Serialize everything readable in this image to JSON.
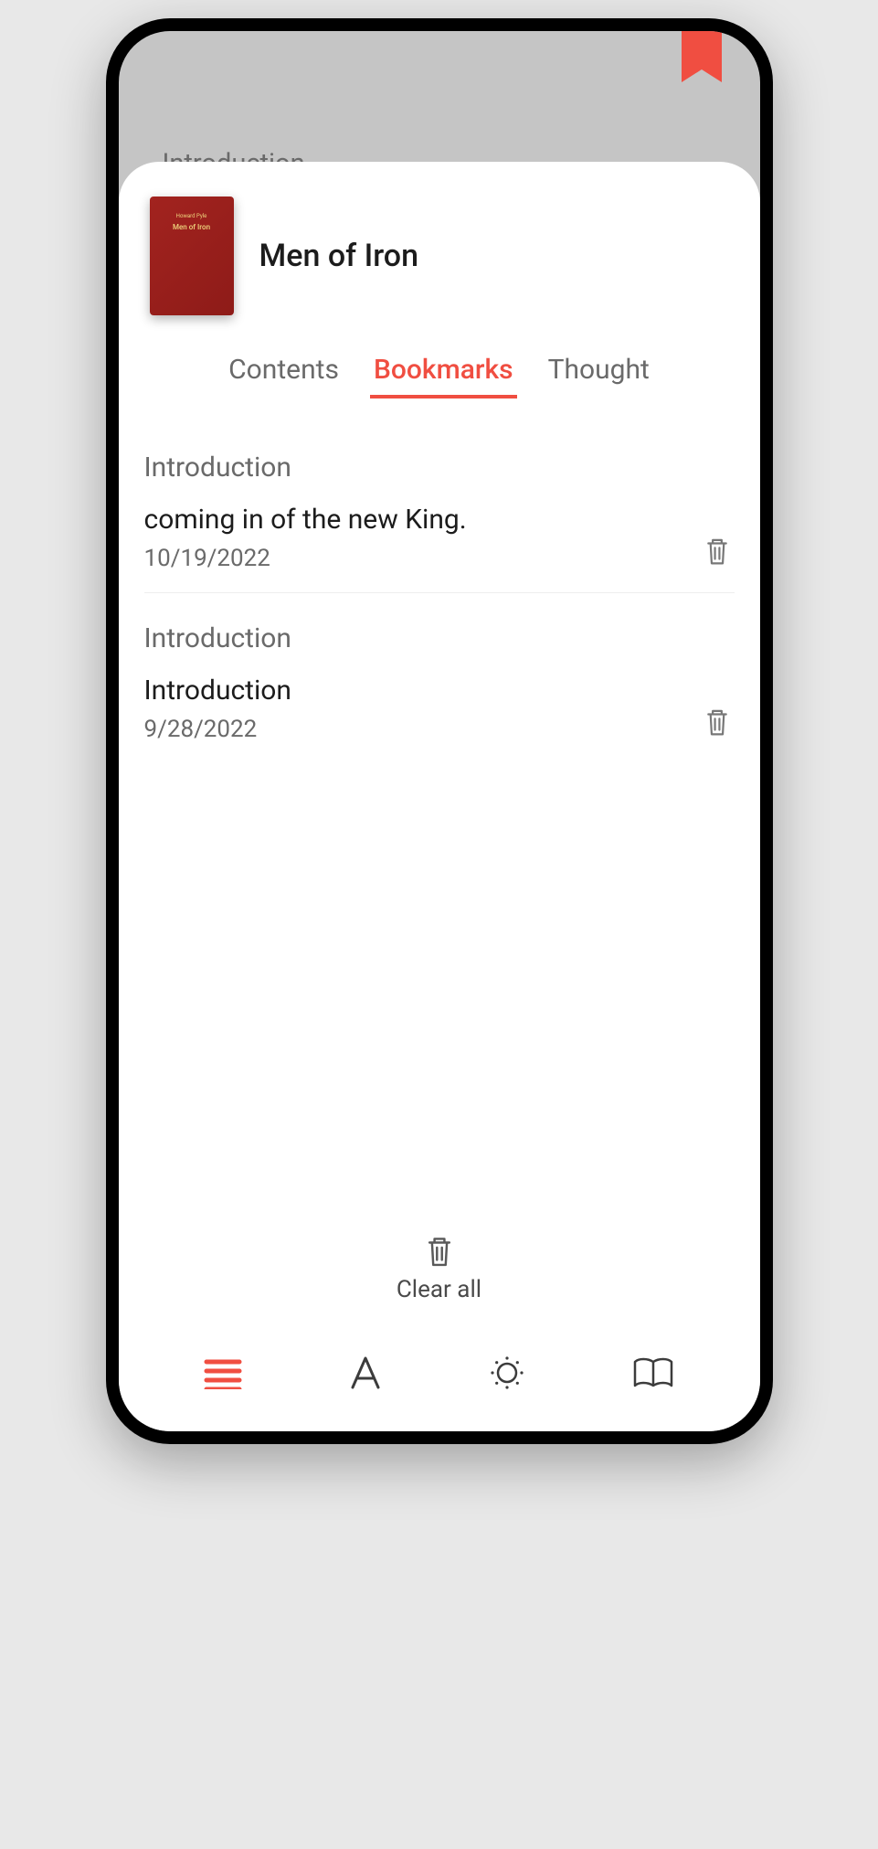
{
  "underlay": {
    "chapter": "Introduction"
  },
  "book": {
    "cover_author": "Howard Pyle",
    "cover_title": "Men of Iron",
    "title": "Men of Iron"
  },
  "tabs": {
    "contents": "Contents",
    "bookmarks": "Bookmarks",
    "thought": "Thought"
  },
  "bookmarks": [
    {
      "chapter": "Introduction",
      "excerpt": "coming in of the new King.",
      "date": "10/19/2022"
    },
    {
      "chapter": "Introduction",
      "excerpt": "Introduction",
      "date": "9/28/2022"
    }
  ],
  "clear_all": {
    "label": "Clear all"
  },
  "colors": {
    "accent": "#f04e41"
  }
}
